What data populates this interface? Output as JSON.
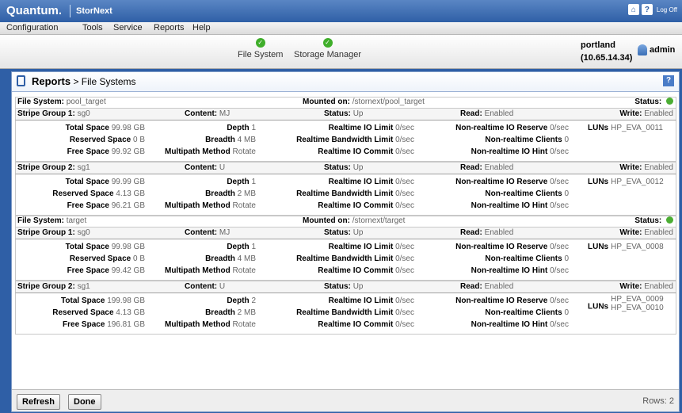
{
  "app": {
    "logo": "Quantum.",
    "product": "StorNext",
    "logoff": "Log Off"
  },
  "menu": [
    "Configuration",
    "Tools",
    "Service",
    "Reports",
    "Help"
  ],
  "nav": {
    "file_system": "File System",
    "storage_manager": "Storage Manager"
  },
  "host": {
    "name": "portland",
    "ip": "(10.65.14.34)"
  },
  "user": {
    "name": "admin"
  },
  "page": {
    "title": "Reports",
    "crumb": "> File Systems"
  },
  "labels": {
    "file_system": "File System:",
    "mounted_on": "Mounted on:",
    "status": "Status:",
    "stripe_group_1": "Stripe Group 1:",
    "stripe_group_2": "Stripe Group 2:",
    "content": "Content:",
    "read": "Read:",
    "write": "Write:",
    "total_space": "Total Space",
    "reserved_space": "Reserved Space",
    "free_space": "Free Space",
    "depth": "Depth",
    "breadth": "Breadth",
    "multipath": "Multipath Method",
    "rt_io_limit": "Realtime IO Limit",
    "rt_bw_limit": "Realtime Bandwidth Limit",
    "rt_io_commit": "Realtime IO Commit",
    "nrt_io_reserve": "Non-realtime IO Reserve",
    "nrt_clients": "Non-realtime Clients",
    "nrt_io_hint": "Non-realtime IO Hint",
    "luns": "LUNs"
  },
  "filesystems": [
    {
      "name": "pool_target",
      "mounted": "/stornext/pool_target",
      "stripe_groups": [
        {
          "name": "sg0",
          "content": "MJ",
          "status": "Up",
          "read": "Enabled",
          "write": "Enabled",
          "total": "99.98 GB",
          "reserved": "0 B",
          "free": "99.92 GB",
          "depth": "1",
          "breadth": "4 MB",
          "multipath": "Rotate",
          "rt_io_limit": "0/sec",
          "rt_bw_limit": "0/sec",
          "rt_io_commit": "0/sec",
          "nrt_io_reserve": "0/sec",
          "nrt_clients": "0",
          "nrt_io_hint": "0/sec",
          "luns": [
            "HP_EVA_0011"
          ]
        },
        {
          "name": "sg1",
          "content": "U",
          "status": "Up",
          "read": "Enabled",
          "write": "Enabled",
          "total": "99.99 GB",
          "reserved": "4.13 GB",
          "free": "96.21 GB",
          "depth": "1",
          "breadth": "2 MB",
          "multipath": "Rotate",
          "rt_io_limit": "0/sec",
          "rt_bw_limit": "0/sec",
          "rt_io_commit": "0/sec",
          "nrt_io_reserve": "0/sec",
          "nrt_clients": "0",
          "nrt_io_hint": "0/sec",
          "luns": [
            "HP_EVA_0012"
          ]
        }
      ]
    },
    {
      "name": "target",
      "mounted": "/stornext/target",
      "stripe_groups": [
        {
          "name": "sg0",
          "content": "MJ",
          "status": "Up",
          "read": "Enabled",
          "write": "Enabled",
          "total": "99.98 GB",
          "reserved": "0 B",
          "free": "99.42 GB",
          "depth": "1",
          "breadth": "4 MB",
          "multipath": "Rotate",
          "rt_io_limit": "0/sec",
          "rt_bw_limit": "0/sec",
          "rt_io_commit": "0/sec",
          "nrt_io_reserve": "0/sec",
          "nrt_clients": "0",
          "nrt_io_hint": "0/sec",
          "luns": [
            "HP_EVA_0008"
          ]
        },
        {
          "name": "sg1",
          "content": "U",
          "status": "Up",
          "read": "Enabled",
          "write": "Enabled",
          "total": "199.98 GB",
          "reserved": "4.13 GB",
          "free": "196.81 GB",
          "depth": "2",
          "breadth": "2 MB",
          "multipath": "Rotate",
          "rt_io_limit": "0/sec",
          "rt_bw_limit": "0/sec",
          "rt_io_commit": "0/sec",
          "nrt_io_reserve": "0/sec",
          "nrt_clients": "0",
          "nrt_io_hint": "0/sec",
          "luns": [
            "HP_EVA_0009",
            "HP_EVA_0010"
          ]
        }
      ]
    }
  ],
  "footer": {
    "refresh": "Refresh",
    "done": "Done",
    "rows": "Rows: 2"
  },
  "colors": {
    "brand": "#2f5fa6",
    "status_ok": "#4cae34"
  }
}
